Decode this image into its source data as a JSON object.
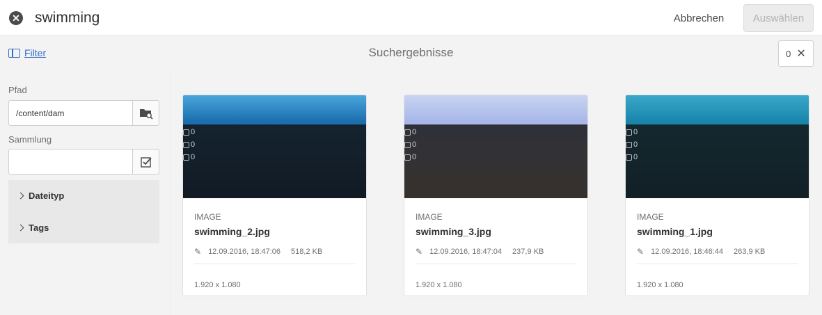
{
  "search": {
    "query": "swimming"
  },
  "header": {
    "cancel_label": "Abbrechen",
    "select_label": "Auswählen"
  },
  "subheader": {
    "filter_label": "Filter",
    "title": "Suchergebnisse",
    "selected_count": "0"
  },
  "filters": {
    "path_label": "Pfad",
    "path_value": "/content/dam",
    "collection_label": "Sammlung",
    "collection_value": "",
    "accordion": [
      {
        "label": "Dateityp"
      },
      {
        "label": "Tags"
      }
    ]
  },
  "results": [
    {
      "type": "IMAGE",
      "title": "swimming_2.jpg",
      "modified": "12.09.2016, 18:47:06",
      "size": "518,2 KB",
      "dimensions": "1.920 x 1.080",
      "stats": [
        "0",
        "0",
        "0"
      ],
      "thumb_colors": [
        "#2e86c4",
        "#0d3f78"
      ]
    },
    {
      "type": "IMAGE",
      "title": "swimming_3.jpg",
      "modified": "12.09.2016, 18:47:04",
      "size": "237,9 KB",
      "dimensions": "1.920 x 1.080",
      "stats": [
        "0",
        "0",
        "0"
      ],
      "thumb_colors": [
        "#a9c0e8",
        "#d7b59a"
      ]
    },
    {
      "type": "IMAGE",
      "title": "swimming_1.jpg",
      "modified": "12.09.2016, 18:46:44",
      "size": "263,9 KB",
      "dimensions": "1.920 x 1.080",
      "stats": [
        "0",
        "0",
        "0"
      ],
      "thumb_colors": [
        "#1d8fb3",
        "#0b5e7a"
      ]
    }
  ],
  "colors": {
    "accent": "#326ec8",
    "panel_bg": "#f3f3f3"
  }
}
